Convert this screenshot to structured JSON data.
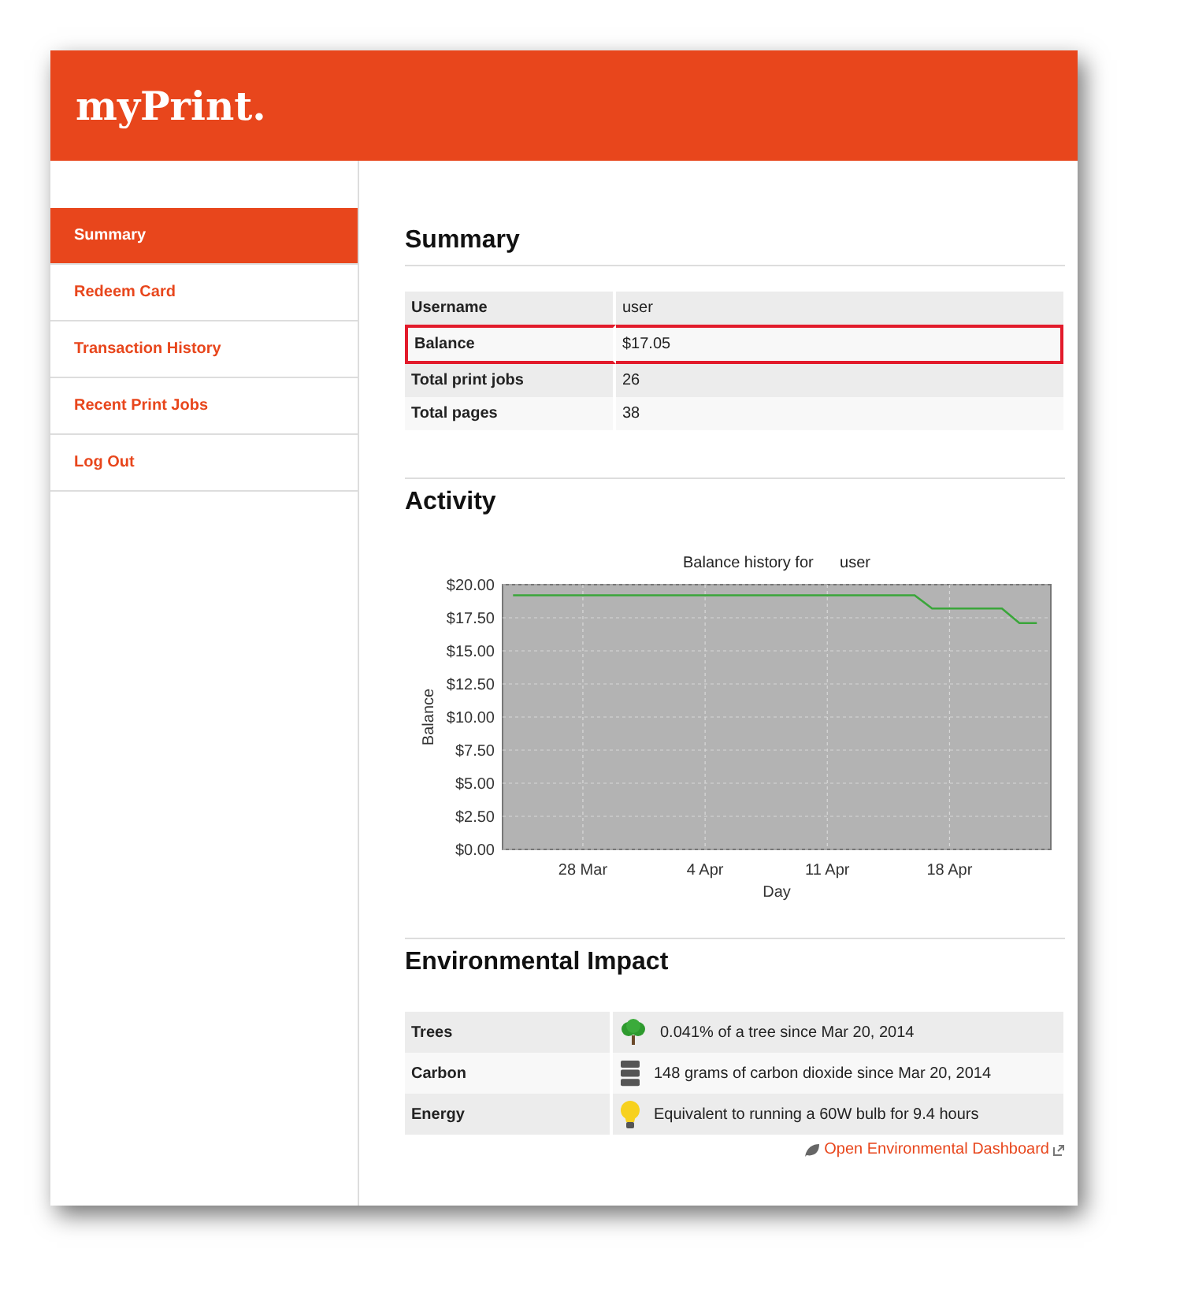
{
  "header": {
    "logo": "myPrint."
  },
  "sidebar": {
    "items": [
      {
        "label": "Summary",
        "selected": true
      },
      {
        "label": "Redeem Card",
        "selected": false
      },
      {
        "label": "Transaction History",
        "selected": false
      },
      {
        "label": "Recent Print Jobs",
        "selected": false
      },
      {
        "label": "Log Out",
        "selected": false
      }
    ]
  },
  "summary": {
    "title": "Summary",
    "rows": [
      {
        "label": "Username",
        "value": "user",
        "highlighted": false
      },
      {
        "label": "Balance",
        "value": "$17.05",
        "highlighted": true
      },
      {
        "label": "Total print jobs",
        "value": "26",
        "highlighted": false
      },
      {
        "label": "Total pages",
        "value": "38",
        "highlighted": false
      }
    ]
  },
  "activity": {
    "title": "Activity",
    "chart_data": {
      "type": "line",
      "title": "Balance history for      user",
      "xlabel": "Day",
      "ylabel": "Balance",
      "categories": [
        null,
        null,
        null,
        null,
        "28 Mar",
        null,
        null,
        null,
        null,
        null,
        null,
        "4 Apr",
        null,
        null,
        null,
        null,
        null,
        null,
        "11 Apr",
        null,
        null,
        null,
        null,
        null,
        null,
        "18 Apr",
        null,
        null,
        null,
        null,
        null
      ],
      "series": [
        {
          "color": "#3aa63a",
          "values": [
            19.2,
            19.2,
            19.2,
            19.2,
            19.2,
            19.2,
            19.2,
            19.2,
            19.2,
            19.2,
            19.2,
            19.2,
            19.2,
            19.2,
            19.2,
            19.2,
            19.2,
            19.2,
            19.2,
            19.2,
            19.2,
            19.2,
            19.2,
            19.2,
            18.2,
            18.2,
            18.2,
            18.2,
            18.2,
            17.1,
            17.1
          ]
        }
      ],
      "ylim": [
        0,
        20
      ],
      "grid": true,
      "yticks": [
        {
          "value": 0,
          "label": "$0.00"
        },
        {
          "value": 2.5,
          "label": "$2.50"
        },
        {
          "value": 5,
          "label": "$5.00"
        },
        {
          "value": 7.5,
          "label": "$7.50"
        },
        {
          "value": 10,
          "label": "$10.00"
        },
        {
          "value": 12.5,
          "label": "$12.50"
        },
        {
          "value": 15,
          "label": "$15.00"
        },
        {
          "value": 17.5,
          "label": "$17.50"
        },
        {
          "value": 20,
          "label": "$20.00"
        }
      ]
    }
  },
  "environment": {
    "title": "Environmental Impact",
    "rows": [
      {
        "kind": "tree",
        "label": "Trees",
        "value": "0.041% of a tree since Mar 20, 2014"
      },
      {
        "kind": "carbon",
        "label": "Carbon",
        "value": "148 grams of carbon dioxide since Mar 20, 2014"
      },
      {
        "kind": "energy",
        "label": "Energy",
        "value": "Equivalent to running a 60W bulb for 9.4 hours"
      }
    ],
    "link": "Open Environmental Dashboard"
  }
}
